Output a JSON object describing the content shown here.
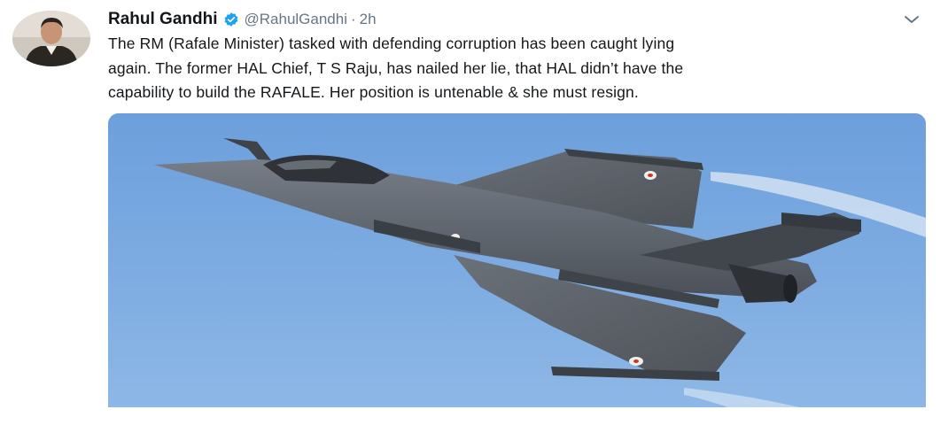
{
  "tweet": {
    "author": {
      "display_name": "Rahul Gandhi",
      "handle": "@RahulGandhi",
      "verified": true,
      "avatar_icon": "profile-photo"
    },
    "separator": "·",
    "timestamp": "2h",
    "text_lines": [
      "The RM (Rafale Minister) tasked with defending corruption has been caught lying",
      "again. The former HAL Chief, T S Raju, has nailed her lie, that HAL didn’t have the",
      "capability to build the RAFALE. Her position is untenable & she must resign."
    ],
    "media": {
      "type": "photo",
      "subject_icon": "fighter-jet"
    },
    "menu_icon": "chevron-down-icon"
  },
  "colors": {
    "text": "#14171a",
    "secondary_text": "#657786",
    "verified_badge": "#1da1f2",
    "sky": "#7aaae2",
    "jet": "#5a6068"
  }
}
